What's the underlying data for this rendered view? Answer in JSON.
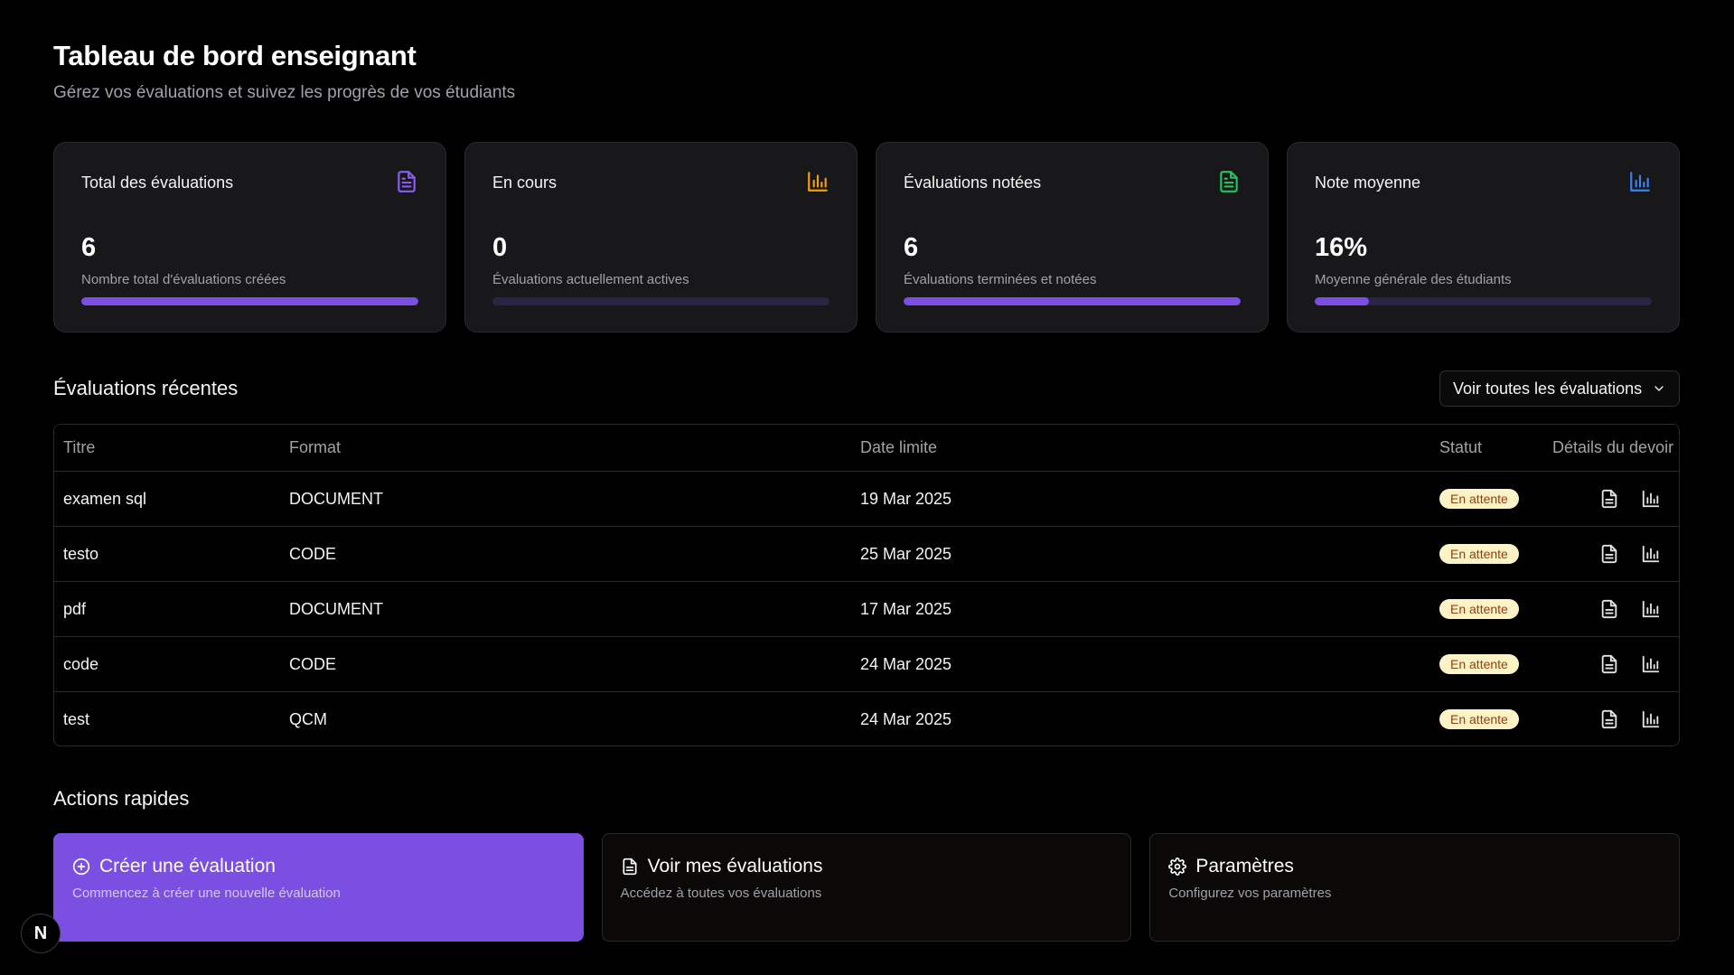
{
  "header": {
    "title": "Tableau de bord enseignant",
    "subtitle": "Gérez vos évaluations et suivez les progrès de vos étudiants"
  },
  "stats": [
    {
      "label": "Total des évaluations",
      "value": "6",
      "description": "Nombre total d'évaluations créées",
      "progress_percent": 100,
      "icon": "document-icon",
      "icon_color": "#8b5cf6"
    },
    {
      "label": "En cours",
      "value": "0",
      "description": "Évaluations actuellement actives",
      "progress_percent": 0,
      "icon": "bar-chart-icon",
      "icon_color": "#f59e0b"
    },
    {
      "label": "Évaluations notées",
      "value": "6",
      "description": "Évaluations terminées et notées",
      "progress_percent": 100,
      "icon": "document-icon",
      "icon_color": "#22c55e"
    },
    {
      "label": "Note moyenne",
      "value": "16%",
      "description": "Moyenne générale des étudiants",
      "progress_percent": 16,
      "icon": "bar-chart-icon",
      "icon_color": "#3b82f6"
    }
  ],
  "recent": {
    "title": "Évaluations récentes",
    "view_all_label": "Voir toutes les évaluations",
    "columns": [
      "Titre",
      "Format",
      "Date limite",
      "Statut",
      "Détails du devoir"
    ],
    "rows": [
      {
        "title": "examen sql",
        "format": "DOCUMENT",
        "date": "19 Mar 2025",
        "status": "En attente"
      },
      {
        "title": "testo",
        "format": "CODE",
        "date": "25 Mar 2025",
        "status": "En attente"
      },
      {
        "title": "pdf",
        "format": "DOCUMENT",
        "date": "17 Mar 2025",
        "status": "En attente"
      },
      {
        "title": "code",
        "format": "CODE",
        "date": "24 Mar 2025",
        "status": "En attente"
      },
      {
        "title": "test",
        "format": "QCM",
        "date": "24 Mar 2025",
        "status": "En attente"
      }
    ]
  },
  "quick_actions": {
    "title": "Actions rapides",
    "items": [
      {
        "label": "Créer une évaluation",
        "description": "Commencez à créer une nouvelle évaluation",
        "icon": "plus-circle-icon"
      },
      {
        "label": "Voir mes évaluations",
        "description": "Accédez à toutes vos évaluations",
        "icon": "document-icon"
      },
      {
        "label": "Paramètres",
        "description": "Configurez vos paramètres",
        "icon": "gear-icon"
      }
    ]
  },
  "colors": {
    "accent": "#7c4fe3",
    "badge_bg": "#fef3c7",
    "badge_text": "#92400e"
  },
  "dev_badge": {
    "label": "N"
  }
}
